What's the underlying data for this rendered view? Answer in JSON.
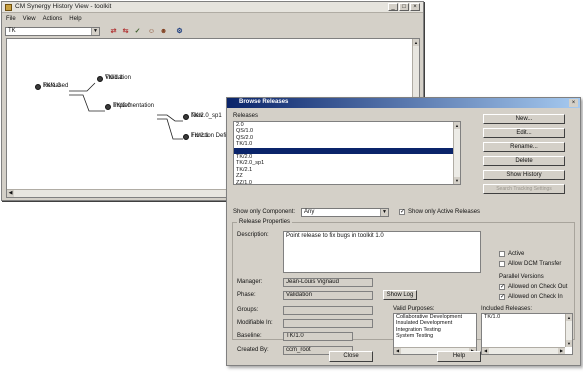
{
  "main_window": {
    "title": "CM Synergy History View - toolkit",
    "title_buttons": [
      "_",
      "□",
      "×"
    ],
    "menu": [
      "File",
      "View",
      "Actions",
      "Help"
    ],
    "object_selector": "TK",
    "toolbar_icons": [
      "compare-icon",
      "merge-icon",
      "check-icon",
      "users-icon",
      "users-alt-icon",
      "settings-icon"
    ]
  },
  "history_graph": {
    "nodes": [
      {
        "name": "TK/1.0",
        "sub": "Released"
      },
      {
        "name": "TK/1.1",
        "sub": "Validation"
      },
      {
        "name": "TK/2.0",
        "sub": "Implementation"
      },
      {
        "name": "TK/2.0_sp1",
        "sub": "New"
      },
      {
        "name": "TK/2.1",
        "sub": "Function Definiti"
      }
    ]
  },
  "dialog": {
    "title": "Browse Releases",
    "releases_label": "Releases",
    "releases": [
      "2.0",
      "QS/1.0",
      "QS/2.0",
      "TK/1.0",
      "TK/1.1",
      "TK/2.0",
      "TK/2.0_sp1",
      "TK/2.1",
      "ZZ",
      "ZZ/1.0"
    ],
    "selected_release_index": 4,
    "buttons": {
      "new": "New...",
      "edit": "Edit...",
      "rename": "Rename...",
      "delete": "Delete",
      "show_history": "Show History",
      "search": "Search Tracking Settings",
      "show_log": "Show Log",
      "close": "Close",
      "help": "Help"
    },
    "show_only_component_label": "Show only Component:",
    "component_value": "Any",
    "show_only_active_label": "Show only Active Releases",
    "show_only_active_checked": true,
    "properties_group": "Release Properties",
    "description_label": "Description:",
    "description": "Point release to fix bugs in toolkit 1.0",
    "active_label": "Active",
    "active_checked": false,
    "allow_dcm_label": "Allow DCM Transfer",
    "allow_dcm_checked": false,
    "parallel_versions_label": "Parallel Versions",
    "allowed_checkout_label": "Allowed on Check Out",
    "allowed_checkout_checked": true,
    "allowed_checkin_label": "Allowed on Check In",
    "allowed_checkin_checked": true,
    "manager_label": "Manager:",
    "manager": "Jean-Louis Vignaud",
    "phase_label": "Phase:",
    "phase": "Validation",
    "groups_label": "Groups:",
    "groups": "",
    "modifiable_label": "Modifiable In:",
    "modifiable": "",
    "baseline_label": "Baseline:",
    "baseline": "TK/1.0",
    "created_by_label": "Created By:",
    "created_by": "ccm_root",
    "valid_purposes_label": "Valid Purposes:",
    "valid_purposes": [
      "Collaborative Development",
      "Insulated Development",
      "Integration Testing",
      "System Testing"
    ],
    "included_releases_label": "Included Releases:",
    "included_releases": [
      "TK/1.0"
    ]
  }
}
